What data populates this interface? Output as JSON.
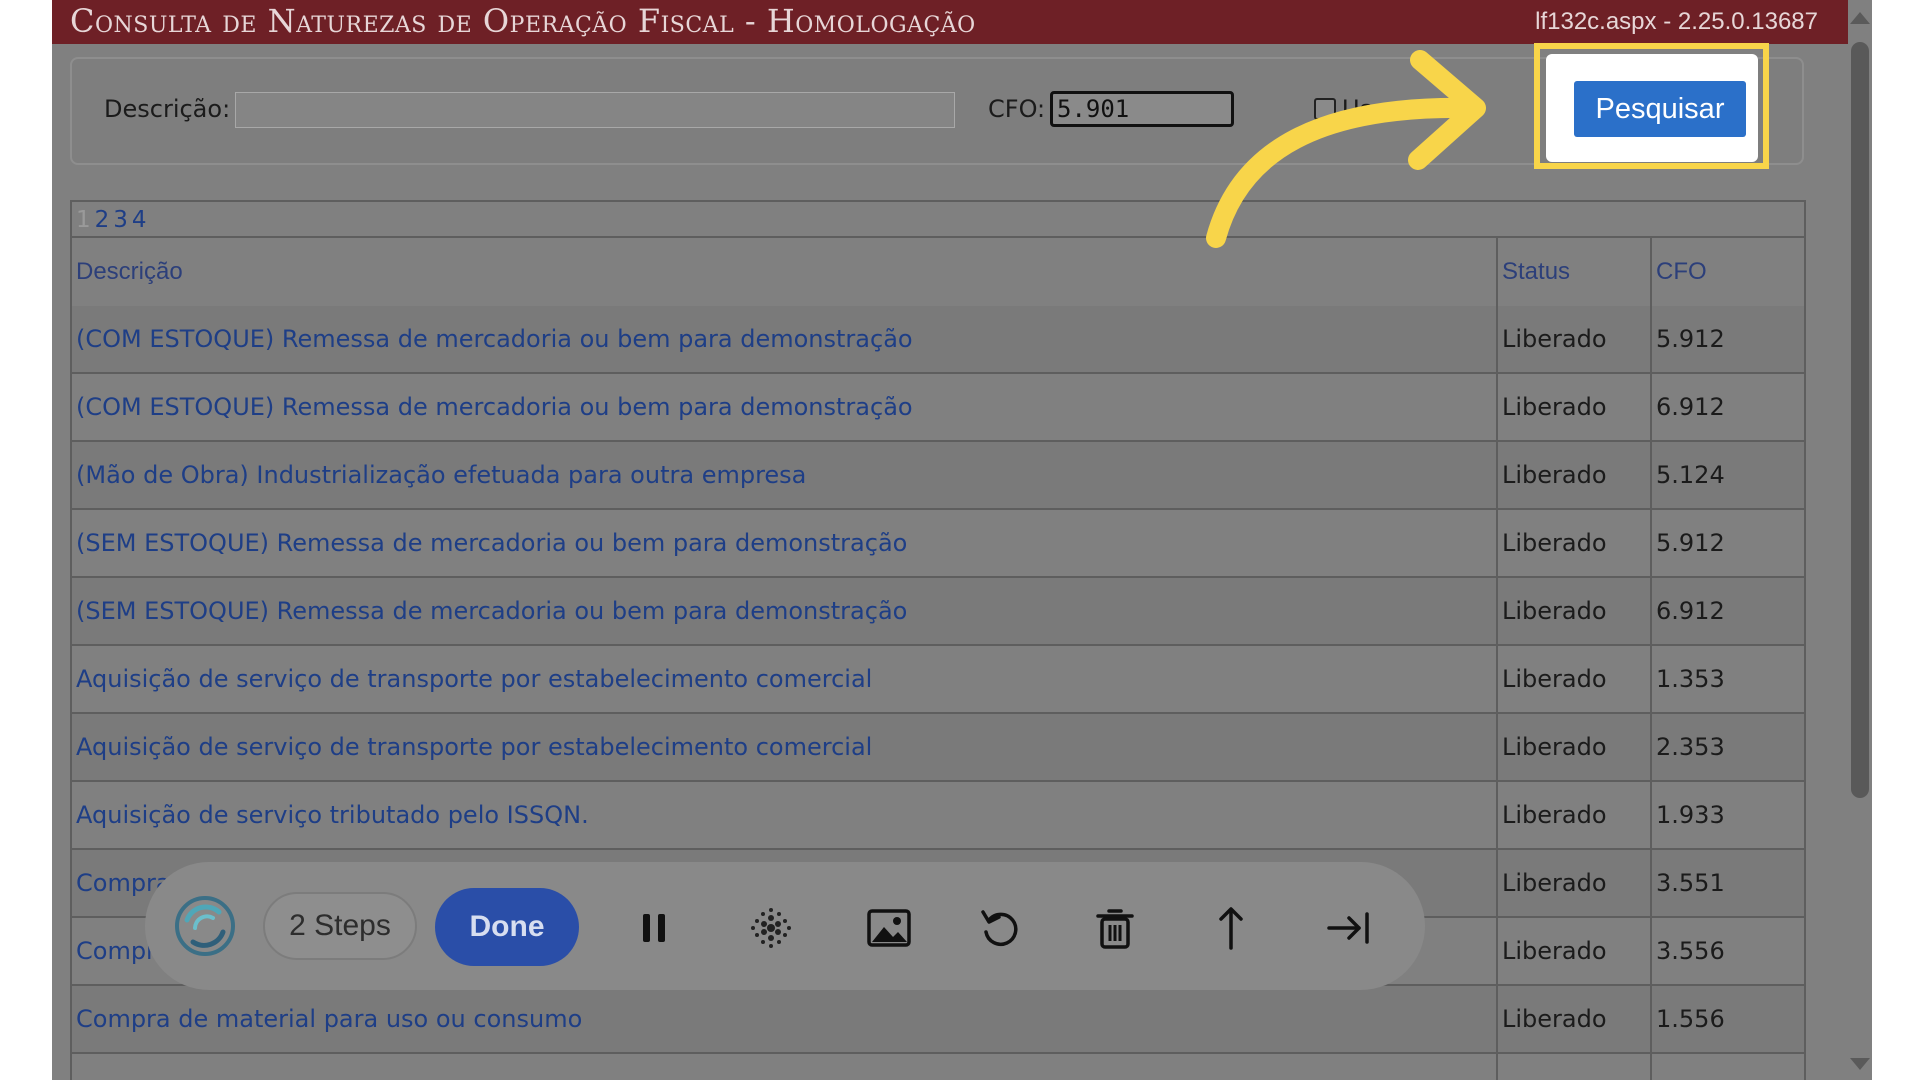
{
  "window": {
    "title": "Consulta de Naturezas de Operação Fiscal  - Homologação",
    "version": "lf132c.aspx - 2.25.0.13687"
  },
  "filters": {
    "descricao_label": "Descrição:",
    "descricao_value": "",
    "cfo_label": "CFO:",
    "cfo_value": "5.901",
    "checkbox_label": "Usar ativos",
    "search_button": "Pesquisar"
  },
  "pager": {
    "pages": [
      "1",
      "2",
      "3",
      "4"
    ],
    "current": "1"
  },
  "table": {
    "columns": [
      "Descrição",
      "Status",
      "CFO"
    ],
    "rows": [
      {
        "descricao": "(COM ESTOQUE) Remessa de mercadoria ou bem para demonstração",
        "status": "Liberado",
        "cfo": "5.912"
      },
      {
        "descricao": "(COM ESTOQUE) Remessa de mercadoria ou bem para demonstração",
        "status": "Liberado",
        "cfo": "6.912"
      },
      {
        "descricao": "(Mão de Obra) Industrialização efetuada para outra empresa",
        "status": "Liberado",
        "cfo": "5.124"
      },
      {
        "descricao": "(SEM ESTOQUE) Remessa de mercadoria ou bem para demonstração",
        "status": "Liberado",
        "cfo": "5.912"
      },
      {
        "descricao": "(SEM ESTOQUE) Remessa de mercadoria ou bem para demonstração",
        "status": "Liberado",
        "cfo": "6.912"
      },
      {
        "descricao": "Aquisição de serviço de transporte por estabelecimento comercial",
        "status": "Liberado",
        "cfo": "1.353"
      },
      {
        "descricao": "Aquisição de serviço de transporte por estabelecimento comercial",
        "status": "Liberado",
        "cfo": "2.353"
      },
      {
        "descricao": "Aquisição de serviço tributado pelo ISSQN.",
        "status": "Liberado",
        "cfo": "1.933"
      },
      {
        "descricao": "Compra",
        "status": "Liberado",
        "cfo": "3.551"
      },
      {
        "descricao": "Compra",
        "status": "Liberado",
        "cfo": "3.556"
      },
      {
        "descricao": "Compra de material para uso ou consumo",
        "status": "Liberado",
        "cfo": "1.556"
      },
      {
        "descricao": "",
        "status": "",
        "cfo": ""
      }
    ]
  },
  "recorder_toolbar": {
    "steps_label": "2 Steps",
    "done_label": "Done",
    "icons": [
      "logo-icon",
      "pause-icon",
      "blur-icon",
      "image-icon",
      "undo-icon",
      "trash-icon",
      "upload-icon",
      "skip-icon"
    ]
  },
  "annotation": {
    "highlight_color": "#f8d54a"
  }
}
